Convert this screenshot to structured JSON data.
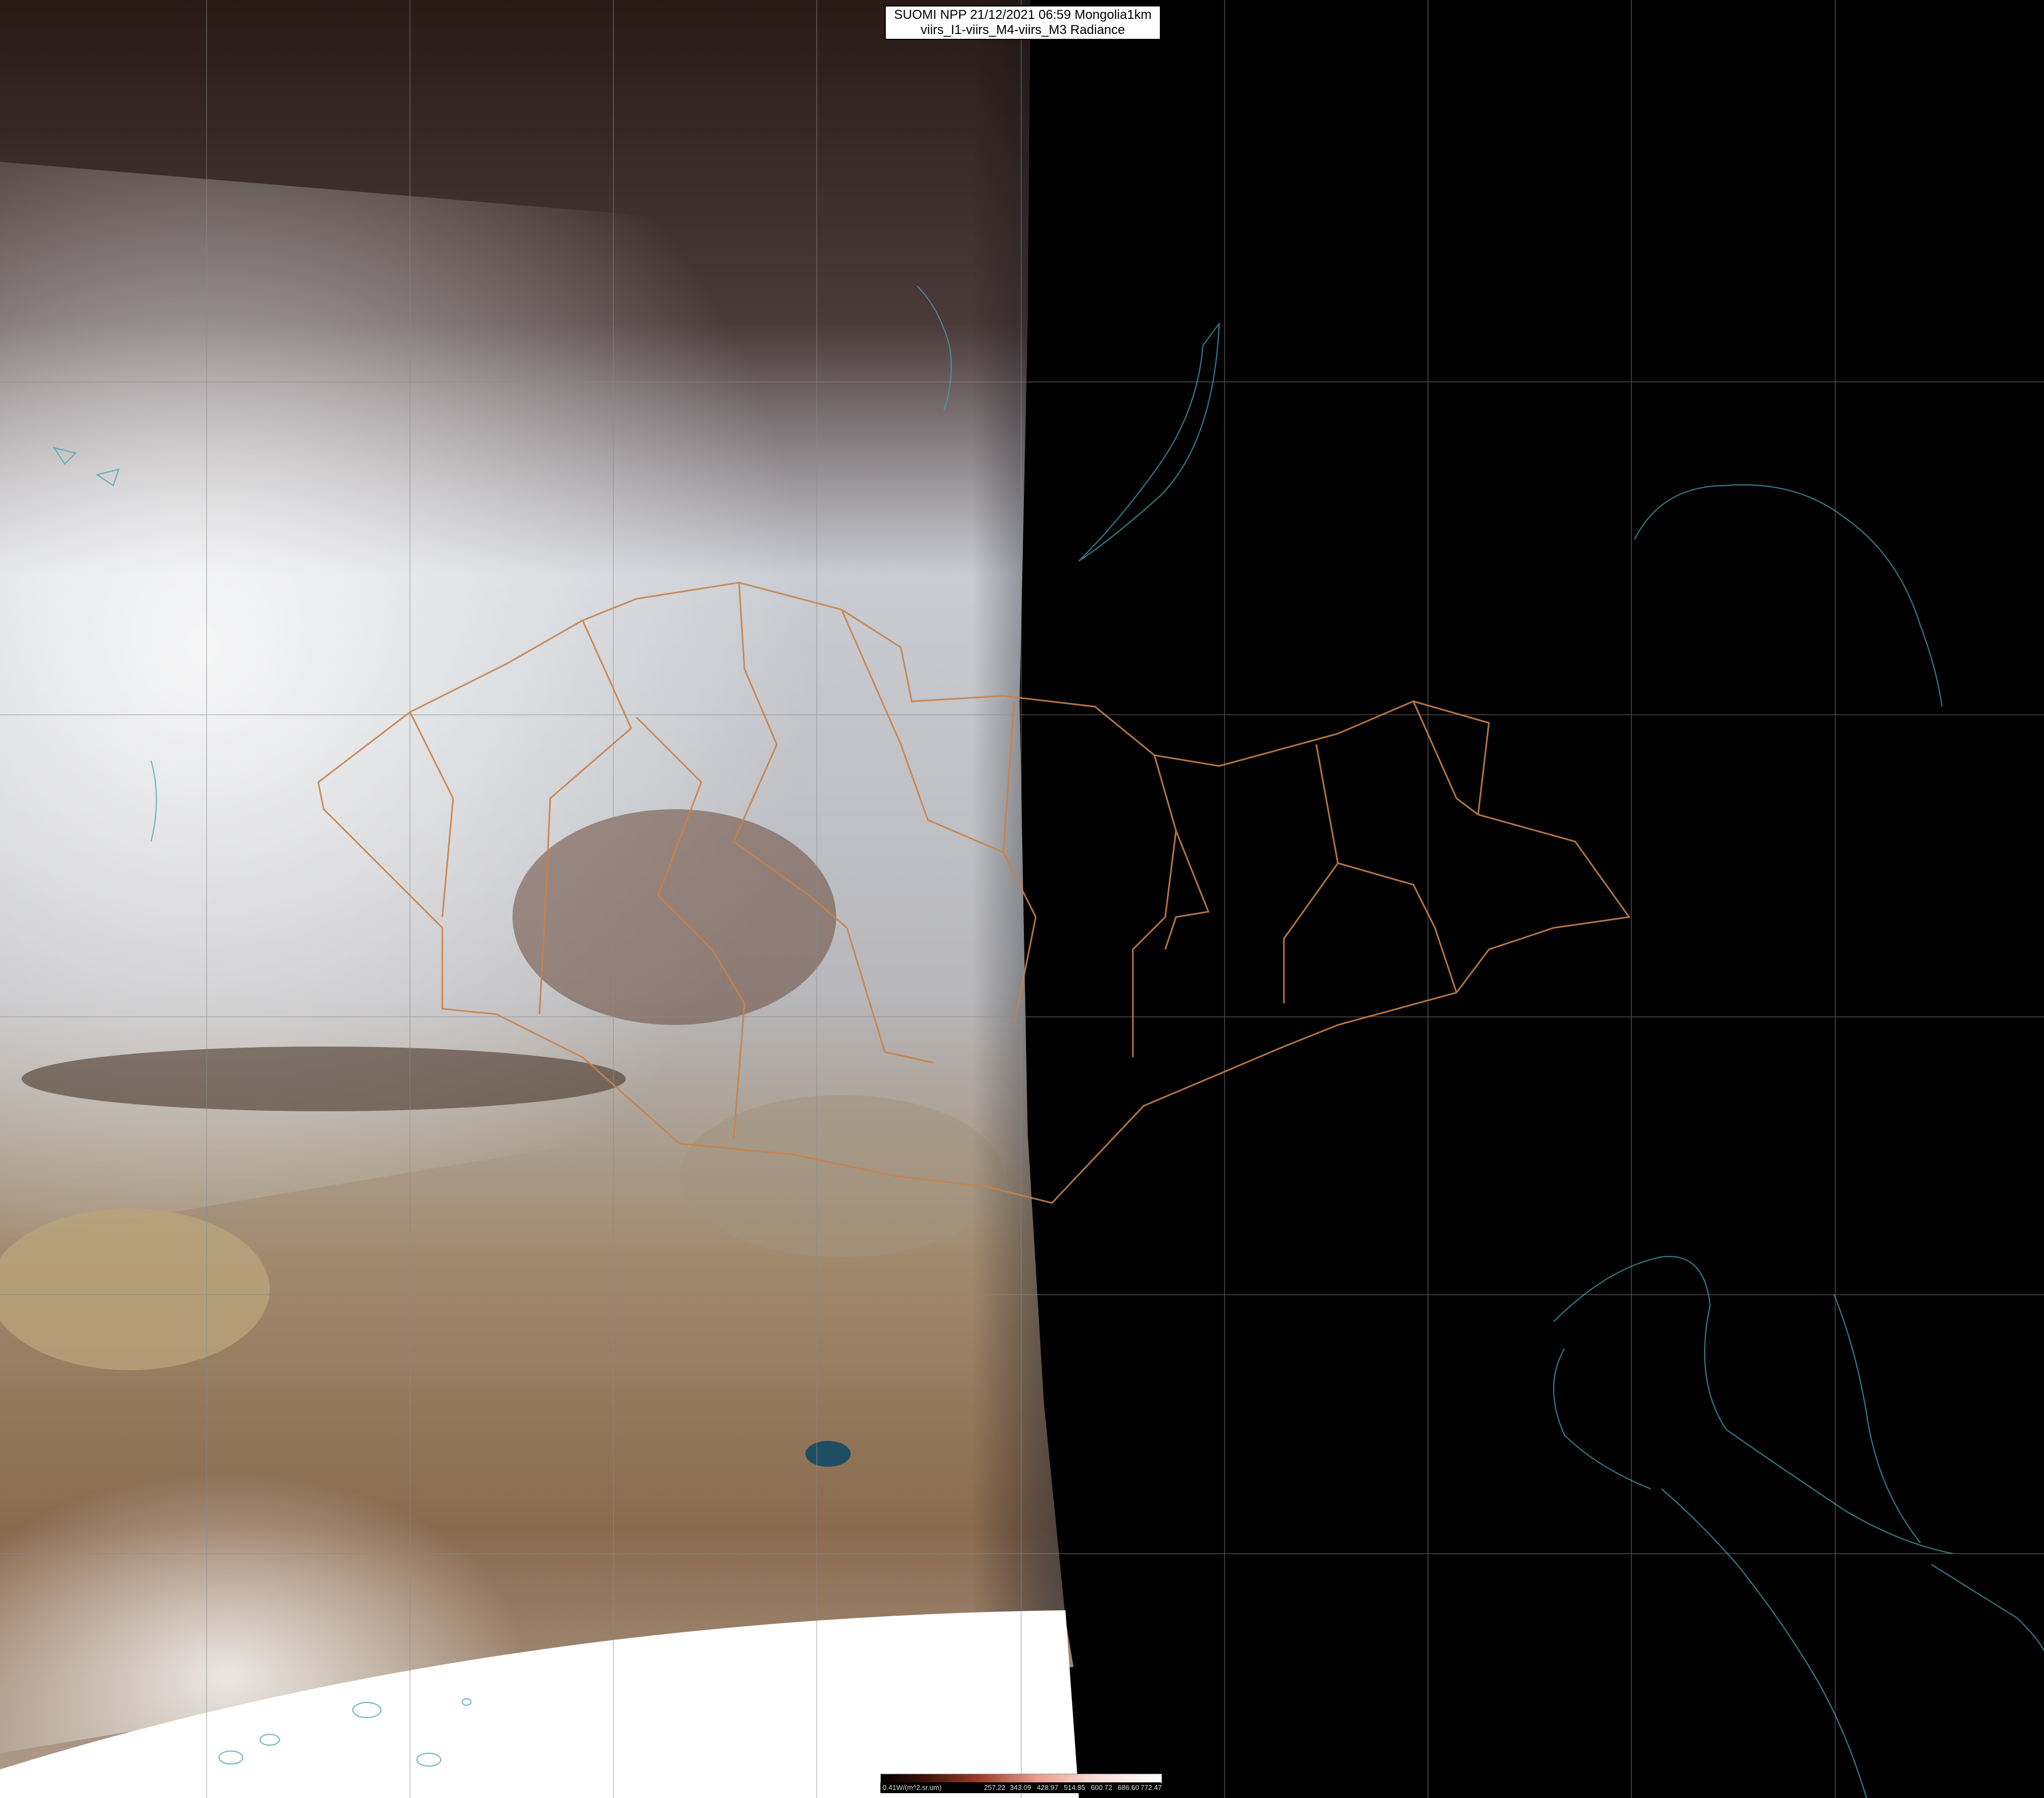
{
  "header": {
    "title_line1": "SUOMI NPP 21/12/2021 06:59 Mongolia1km",
    "title_line2": "viirs_I1-viirs_M4-viirs_M3 Radiance"
  },
  "colorbar": {
    "labels": [
      "0.41W/(m^2.sr.um)",
      "257.22",
      "343.09",
      "428.97",
      "514.85",
      "600.72",
      "686.60",
      "772.47"
    ]
  },
  "colors": {
    "border_admin": "#c8824a",
    "coastline": "#4aa0b0",
    "graticule": "#8a8a8a",
    "night_side": "#000000",
    "no_data": "#ffffff"
  }
}
